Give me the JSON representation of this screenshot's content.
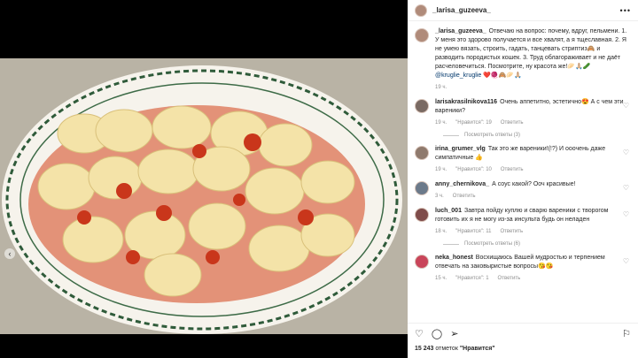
{
  "post": {
    "username": "_larisa_guzeeva_",
    "more_icon": "more-dots-icon",
    "caption": "Отвечаю на вопрос: почему, вдруг, пельмени. 1. У меня это здорово получается и все хвалят, а я тщеславная. 2. Я не умею вязать, строить, гадать, танцевать стриптиз🙈 и разводить породистых кошек. 3. Труд облагораживает и не даёт расчеловечиться. Посмотрите, ну красота же!🥟🙏🏼🥒 ",
    "caption_mention": "@kruglie_kruglie",
    "caption_tail": " ❤️🧶🙈🥟🙏🏼",
    "caption_time": "19 ч."
  },
  "comments": [
    {
      "user": "larisakrasilnikova116",
      "text": "Очень аппетитно, эстетично😍 А с чем эти вареники?",
      "time": "19 ч.",
      "likes": "\"Нравится\": 19",
      "reply": "Ответить",
      "replies": "Посмотреть ответы (3)"
    },
    {
      "user": "irina_grumer_vlg",
      "text": "Так это же вареники!(!?) И ооочень даже симпатичные 👍",
      "time": "19 ч.",
      "likes": "\"Нравится\": 10",
      "reply": "Ответить",
      "replies": ""
    },
    {
      "user": "anny_chernikova_",
      "text": "А соус какой? Ооч красивые!",
      "time": "3 ч.",
      "likes": "",
      "reply": "Ответить",
      "replies": ""
    },
    {
      "user": "luch_001",
      "text": "Завтра пойду куплю и сварю вареники с творогом готовить их я не могу из-за инсульта будь он неладен",
      "time": "18 ч.",
      "likes": "\"Нравится\": 11",
      "reply": "Ответить",
      "replies": "Посмотреть ответы (6)"
    },
    {
      "user": "neka_honest",
      "text": "Восхищаюсь Вашей мудростью и терпением отвечать на заковыристые вопросы😘😘",
      "time": "15 ч.",
      "likes": "\"Нравится\": 1",
      "reply": "Ответить",
      "replies": ""
    }
  ],
  "actions": {
    "like_icon": "heart-icon",
    "comment_icon": "comment-icon",
    "share_icon": "share-icon",
    "save_icon": "bookmark-icon"
  },
  "likes_count": "15 243",
  "likes_word": "отметок ",
  "likes_quote": "\"Нравится\"",
  "colors": {
    "plate_border": "#2f5b3a",
    "sauce": "#d4421a",
    "dumpling": "#f4e3a8"
  }
}
